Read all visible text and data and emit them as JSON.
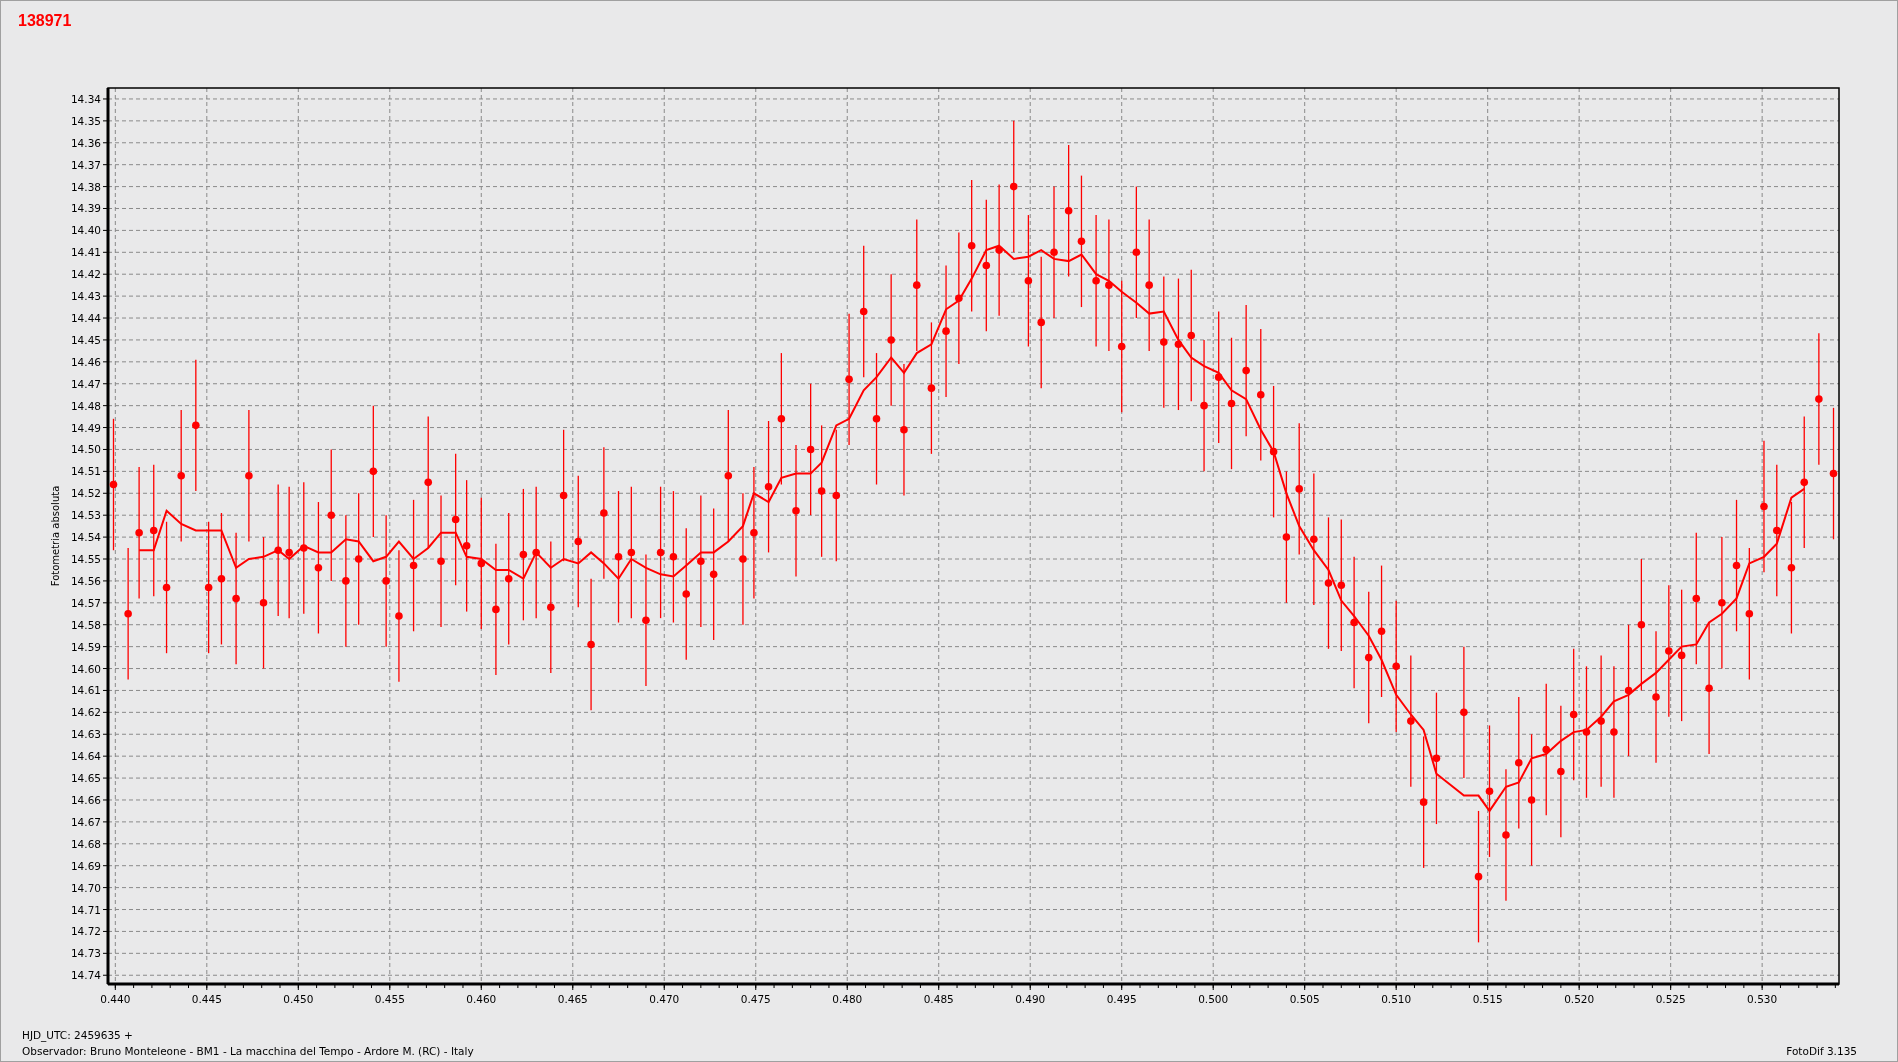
{
  "title": "138971",
  "chart": {
    "chart_data": {
      "type": "scatter",
      "grid": true,
      "ylabel": "Fotometria absoluta",
      "xlim": [
        0.4396,
        0.5342
      ],
      "ylim": [
        14.744,
        14.335
      ],
      "xticks": [
        {
          "value": 0.44,
          "label": "0.440"
        },
        {
          "value": 0.445,
          "label": "0.445"
        },
        {
          "value": 0.45,
          "label": "0.450"
        },
        {
          "value": 0.455,
          "label": "0.455"
        },
        {
          "value": 0.46,
          "label": "0.460"
        },
        {
          "value": 0.465,
          "label": "0.465"
        },
        {
          "value": 0.47,
          "label": "0.470"
        },
        {
          "value": 0.475,
          "label": "0.475"
        },
        {
          "value": 0.48,
          "label": "0.480"
        },
        {
          "value": 0.485,
          "label": "0.485"
        },
        {
          "value": 0.49,
          "label": "0.490"
        },
        {
          "value": 0.495,
          "label": "0.495"
        },
        {
          "value": 0.5,
          "label": "0.500"
        },
        {
          "value": 0.505,
          "label": "0.505"
        },
        {
          "value": 0.51,
          "label": "0.510"
        },
        {
          "value": 0.515,
          "label": "0.515"
        },
        {
          "value": 0.52,
          "label": "0.520"
        },
        {
          "value": 0.525,
          "label": "0.525"
        },
        {
          "value": 0.53,
          "label": "0.530"
        }
      ],
      "yticks": [
        {
          "value": 14.34,
          "label": "14.34"
        },
        {
          "value": 14.35,
          "label": "14.35"
        },
        {
          "value": 14.36,
          "label": "14.36"
        },
        {
          "value": 14.37,
          "label": "14.37"
        },
        {
          "value": 14.38,
          "label": "14.38"
        },
        {
          "value": 14.39,
          "label": "14.39"
        },
        {
          "value": 14.4,
          "label": "14.40"
        },
        {
          "value": 14.41,
          "label": "14.41"
        },
        {
          "value": 14.42,
          "label": "14.42"
        },
        {
          "value": 14.43,
          "label": "14.43"
        },
        {
          "value": 14.44,
          "label": "14.44"
        },
        {
          "value": 14.45,
          "label": "14.45"
        },
        {
          "value": 14.46,
          "label": "14.46"
        },
        {
          "value": 14.47,
          "label": "14.47"
        },
        {
          "value": 14.48,
          "label": "14.48"
        },
        {
          "value": 14.49,
          "label": "14.49"
        },
        {
          "value": 14.5,
          "label": "14.50"
        },
        {
          "value": 14.51,
          "label": "14.51"
        },
        {
          "value": 14.52,
          "label": "14.52"
        },
        {
          "value": 14.53,
          "label": "14.53"
        },
        {
          "value": 14.54,
          "label": "14.54"
        },
        {
          "value": 14.55,
          "label": "14.55"
        },
        {
          "value": 14.56,
          "label": "14.56"
        },
        {
          "value": 14.57,
          "label": "14.57"
        },
        {
          "value": 14.58,
          "label": "14.58"
        },
        {
          "value": 14.59,
          "label": "14.59"
        },
        {
          "value": 14.6,
          "label": "14.60"
        },
        {
          "value": 14.61,
          "label": "14.61"
        },
        {
          "value": 14.62,
          "label": "14.62"
        },
        {
          "value": 14.63,
          "label": "14.63"
        },
        {
          "value": 14.64,
          "label": "14.64"
        },
        {
          "value": 14.65,
          "label": "14.65"
        },
        {
          "value": 14.66,
          "label": "14.66"
        },
        {
          "value": 14.67,
          "label": "14.67"
        },
        {
          "value": 14.68,
          "label": "14.68"
        },
        {
          "value": 14.69,
          "label": "14.69"
        },
        {
          "value": 14.7,
          "label": "14.70"
        },
        {
          "value": 14.71,
          "label": "14.71"
        },
        {
          "value": 14.72,
          "label": "14.72"
        },
        {
          "value": 14.73,
          "label": "14.73"
        },
        {
          "value": 14.74,
          "label": "14.74"
        }
      ],
      "x": [
        0.4399,
        0.4407,
        0.4413,
        0.4421,
        0.4428,
        0.4436,
        0.4444,
        0.4451,
        0.4458,
        0.4466,
        0.4473,
        0.4481,
        0.4489,
        0.4495,
        0.4503,
        0.4511,
        0.4518,
        0.4526,
        0.4533,
        0.4541,
        0.4548,
        0.4555,
        0.4563,
        0.4571,
        0.4578,
        0.4586,
        0.4592,
        0.46,
        0.4608,
        0.4615,
        0.4623,
        0.463,
        0.4638,
        0.4645,
        0.4653,
        0.466,
        0.4667,
        0.4675,
        0.4682,
        0.469,
        0.4698,
        0.4705,
        0.4712,
        0.472,
        0.4727,
        0.4735,
        0.4743,
        0.4749,
        0.4757,
        0.4764,
        0.4772,
        0.478,
        0.4786,
        0.4794,
        0.4801,
        0.4809,
        0.4816,
        0.4824,
        0.4831,
        0.4838,
        0.4846,
        0.4854,
        0.4861,
        0.4868,
        0.4876,
        0.4883,
        0.4891,
        0.4899,
        0.4906,
        0.4913,
        0.4921,
        0.4928,
        0.4936,
        0.4943,
        0.495,
        0.4958,
        0.4965,
        0.4973,
        0.4981,
        0.4988,
        0.4995,
        0.5003,
        0.501,
        0.5018,
        0.5026,
        0.5033,
        0.504,
        0.5047,
        0.5055,
        0.5063,
        0.507,
        0.5077,
        0.5085,
        0.5092,
        0.51,
        0.5108,
        0.5115,
        0.5122,
        0.5137,
        0.5145,
        0.5151,
        0.516,
        0.5167,
        0.5174,
        0.5182,
        0.519,
        0.5197,
        0.5204,
        0.5212,
        0.5219,
        0.5227,
        0.5234,
        0.5242,
        0.5249,
        0.5256,
        0.5264,
        0.5271,
        0.5278,
        0.5286,
        0.5293,
        0.5301,
        0.5308,
        0.5316,
        0.5323,
        0.5331,
        0.5339
      ],
      "series": [
        {
          "type": "scatter",
          "color": "#ff0000",
          "errors": [
            0.03,
            0.03,
            0.03,
            0.03,
            0.03,
            0.03,
            0.03,
            0.03,
            0.03,
            0.03,
            0.03,
            0.03,
            0.03,
            0.03,
            0.03,
            0.03,
            0.03,
            0.03,
            0.03,
            0.03,
            0.03,
            0.03,
            0.03,
            0.03,
            0.03,
            0.03,
            0.03,
            0.03,
            0.03,
            0.03,
            0.03,
            0.03,
            0.03,
            0.03,
            0.03,
            0.03,
            0.03,
            0.03,
            0.03,
            0.03,
            0.03,
            0.03,
            0.03,
            0.03,
            0.03,
            0.03,
            0.03,
            0.03,
            0.03,
            0.03,
            0.03,
            0.03,
            0.03,
            0.03,
            0.03,
            0.03,
            0.03,
            0.03,
            0.03,
            0.03,
            0.03,
            0.03,
            0.03,
            0.03,
            0.03,
            0.03,
            0.03,
            0.03,
            0.03,
            0.03,
            0.03,
            0.03,
            0.03,
            0.03,
            0.03,
            0.03,
            0.03,
            0.03,
            0.03,
            0.03,
            0.03,
            0.03,
            0.03,
            0.03,
            0.03,
            0.03,
            0.03,
            0.03,
            0.03,
            0.03,
            0.03,
            0.03,
            0.03,
            0.03,
            0.03,
            0.03,
            0.03,
            0.03,
            0.03,
            0.03,
            0.03,
            0.03,
            0.03,
            0.03,
            0.03,
            0.03,
            0.03,
            0.03,
            0.03,
            0.03,
            0.03,
            0.03,
            0.03,
            0.03,
            0.03,
            0.03,
            0.03,
            0.03,
            0.03,
            0.03,
            0.03,
            0.03,
            0.03,
            0.03,
            0.03,
            0.03
          ],
          "values": [
            14.516,
            14.575,
            14.538,
            14.537,
            14.563,
            14.512,
            14.489,
            14.563,
            14.559,
            14.568,
            14.512,
            14.57,
            14.546,
            14.547,
            14.545,
            14.554,
            14.53,
            14.56,
            14.55,
            14.51,
            14.56,
            14.576,
            14.553,
            14.515,
            14.551,
            14.532,
            14.544,
            14.552,
            14.573,
            14.559,
            14.548,
            14.547,
            14.572,
            14.521,
            14.542,
            14.589,
            14.529,
            14.549,
            14.547,
            14.578,
            14.547,
            14.549,
            14.566,
            14.551,
            14.557,
            14.512,
            14.55,
            14.538,
            14.517,
            14.486,
            14.528,
            14.5,
            14.519,
            14.521,
            14.468,
            14.437,
            14.486,
            14.45,
            14.491,
            14.425,
            14.472,
            14.446,
            14.431,
            14.407,
            14.416,
            14.409,
            14.38,
            14.423,
            14.442,
            14.41,
            14.391,
            14.405,
            14.423,
            14.425,
            14.453,
            14.41,
            14.425,
            14.451,
            14.452,
            14.448,
            14.48,
            14.467,
            14.479,
            14.464,
            14.475,
            14.501,
            14.54,
            14.518,
            14.541,
            14.561,
            14.562,
            14.579,
            14.595,
            14.583,
            14.599,
            14.624,
            14.661,
            14.641,
            14.62,
            14.695,
            14.656,
            14.676,
            14.643,
            14.66,
            14.637,
            14.647,
            14.621,
            14.629,
            14.624,
            14.629,
            14.61,
            14.58,
            14.613,
            14.592,
            14.594,
            14.568,
            14.609,
            14.57,
            14.553,
            14.575,
            14.526,
            14.537,
            14.554,
            14.515,
            14.477,
            14.511
          ]
        },
        {
          "type": "line",
          "color": "#ff0000",
          "values": [
            null,
            null,
            14.546,
            14.546,
            14.528,
            14.534,
            14.537,
            14.537,
            14.537,
            14.554,
            14.55,
            14.549,
            14.546,
            14.55,
            14.544,
            14.547,
            14.547,
            14.541,
            14.542,
            14.551,
            14.549,
            14.542,
            14.55,
            14.545,
            14.538,
            14.538,
            14.549,
            14.55,
            14.555,
            14.555,
            14.559,
            14.547,
            14.554,
            14.55,
            14.552,
            14.547,
            14.552,
            14.559,
            14.55,
            14.554,
            14.557,
            14.558,
            14.553,
            14.547,
            14.547,
            14.542,
            14.535,
            14.52,
            14.524,
            14.513,
            14.511,
            14.511,
            14.506,
            14.489,
            14.486,
            14.473,
            14.467,
            14.458,
            14.465,
            14.456,
            14.452,
            14.436,
            14.432,
            14.422,
            14.409,
            14.407,
            14.413,
            14.412,
            14.409,
            14.413,
            14.414,
            14.411,
            14.42,
            14.423,
            14.428,
            14.433,
            14.438,
            14.437,
            14.45,
            14.458,
            14.462,
            14.465,
            14.473,
            14.477,
            14.491,
            14.501,
            14.52,
            14.535,
            14.546,
            14.555,
            14.569,
            14.576,
            14.585,
            14.596,
            14.612,
            14.621,
            14.628,
            14.648,
            14.658,
            14.658,
            14.665,
            14.654,
            14.652,
            14.641,
            14.639,
            14.633,
            14.629,
            14.628,
            14.622,
            14.615,
            14.612,
            14.607,
            14.602,
            14.596,
            14.59,
            14.589,
            14.579,
            14.575,
            14.568,
            14.552,
            14.549,
            14.543,
            14.522,
            14.518,
            null,
            null
          ]
        }
      ]
    }
  },
  "footer": {
    "epoch": "HJD_UTC: 2459635 +",
    "observer": "Observador: Bruno Monteleone - BM1 - La macchina del Tempo - Ardore M. (RC) - Italy",
    "software": "FotoDif 3.135"
  }
}
